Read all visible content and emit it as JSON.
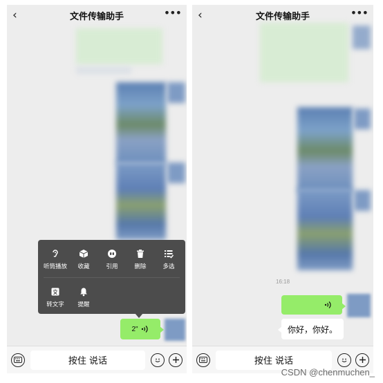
{
  "left_screen": {
    "title": "文件传输助手",
    "back_icon": "chevron-left-icon",
    "more_icon": "more-dots-icon",
    "context_menu": {
      "row1": [
        {
          "label": "听筒播放",
          "icon": "ear-icon"
        },
        {
          "label": "收藏",
          "icon": "cube-icon"
        },
        {
          "label": "引用",
          "icon": "quote-icon"
        },
        {
          "label": "删除",
          "icon": "trash-icon"
        },
        {
          "label": "多选",
          "icon": "multiselect-icon"
        }
      ],
      "row2": [
        {
          "label": "转文字",
          "icon": "text-convert-icon"
        },
        {
          "label": "提醒",
          "icon": "bell-icon"
        }
      ]
    },
    "voice_message": {
      "duration": "2\"",
      "icon": "voice-wave-icon"
    },
    "bottom_bar": {
      "hold_to_talk": "按住 说话",
      "left_icon": "keyboard-icon",
      "emoji_icon": "emoji-icon",
      "plus_icon": "plus-circle-icon"
    }
  },
  "right_screen": {
    "title": "文件传输助手",
    "back_icon": "chevron-left-icon",
    "more_icon": "more-dots-icon",
    "timestamp": "16:18",
    "voice_message": {
      "icon": "voice-wave-icon"
    },
    "transcribed_text": "你好，你好。",
    "bottom_bar": {
      "hold_to_talk": "按住 说话",
      "left_icon": "keyboard-icon",
      "emoji_icon": "emoji-icon",
      "plus_icon": "plus-circle-icon"
    }
  },
  "watermark": "CSDN @chenmuchen_",
  "colors": {
    "bubble_green": "#95ec69",
    "menu_bg": "#4c4c4c",
    "chat_bg": "#ededed"
  }
}
